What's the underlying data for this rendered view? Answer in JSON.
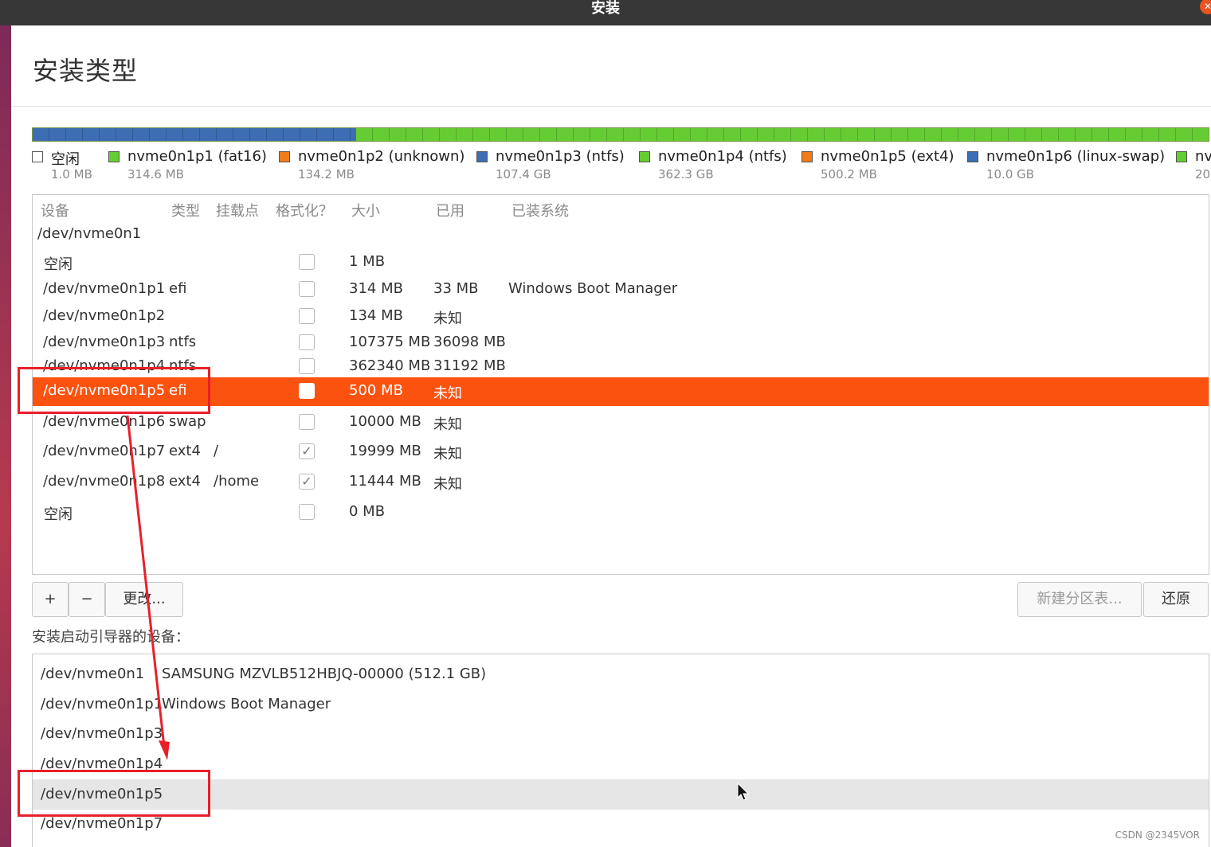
{
  "window": {
    "title": "安装"
  },
  "page": {
    "heading": "安装类型"
  },
  "partition_bar": [
    {
      "color": "#3d6eb4",
      "fraction": 0.275
    },
    {
      "color": "#66cc33",
      "fraction": 0.725
    }
  ],
  "legend": [
    {
      "name": "空闲",
      "size": "1.0 MB",
      "color": "#ffffff"
    },
    {
      "name": "nvme0n1p1 (fat16)",
      "size": "314.6 MB",
      "color": "#66cc33"
    },
    {
      "name": "nvme0n1p2 (unknown)",
      "size": "134.2 MB",
      "color": "#f07b1a"
    },
    {
      "name": "nvme0n1p3 (ntfs)",
      "size": "107.4 GB",
      "color": "#3d6eb4"
    },
    {
      "name": "nvme0n1p4 (ntfs)",
      "size": "362.3 GB",
      "color": "#66cc33"
    },
    {
      "name": "nvme0n1p5 (ext4)",
      "size": "500.2 MB",
      "color": "#f07b1a"
    },
    {
      "name": "nvme0n1p6 (linux-swap)",
      "size": "10.0 GB",
      "color": "#3d6eb4"
    },
    {
      "name": "nv",
      "size": "20",
      "color": "#66cc33"
    }
  ],
  "table": {
    "headers": {
      "device": "设备",
      "type": "类型",
      "mount": "挂载点",
      "format": "格式化？",
      "size": "大小",
      "used": "已用",
      "system": "已装系统"
    },
    "disk": "/dev/nvme0n1",
    "rows": [
      {
        "device": "空闲",
        "type": "",
        "mount": "",
        "format": false,
        "size": "1 MB",
        "used": "",
        "system": ""
      },
      {
        "device": "/dev/nvme0n1p1",
        "type": "efi",
        "mount": "",
        "format": false,
        "size": "314 MB",
        "used": "33 MB",
        "system": "Windows Boot Manager"
      },
      {
        "device": "/dev/nvme0n1p2",
        "type": "",
        "mount": "",
        "format": false,
        "size": "134 MB",
        "used": "未知",
        "system": ""
      },
      {
        "device": "/dev/nvme0n1p3",
        "type": "ntfs",
        "mount": "",
        "format": false,
        "size": "107375 MB",
        "used": "36098 MB",
        "system": ""
      },
      {
        "device": "/dev/nvme0n1p4",
        "type": "ntfs",
        "mount": "",
        "format": false,
        "size": "362340 MB",
        "used": "31192 MB",
        "system": ""
      },
      {
        "device": "/dev/nvme0n1p5",
        "type": "efi",
        "mount": "",
        "format": false,
        "size": "500 MB",
        "used": "未知",
        "system": "",
        "selected": true
      },
      {
        "device": "/dev/nvme0n1p6",
        "type": "swap",
        "mount": "",
        "format": false,
        "size": "10000 MB",
        "used": "未知",
        "system": ""
      },
      {
        "device": "/dev/nvme0n1p7",
        "type": "ext4",
        "mount": "/",
        "format": true,
        "size": "19999 MB",
        "used": "未知",
        "system": ""
      },
      {
        "device": "/dev/nvme0n1p8",
        "type": "ext4",
        "mount": "/home",
        "format": true,
        "size": "11444 MB",
        "used": "未知",
        "system": ""
      },
      {
        "device": "空闲",
        "type": "",
        "mount": "",
        "format": false,
        "size": "0 MB",
        "used": "",
        "system": ""
      }
    ]
  },
  "buttons": {
    "add": "+",
    "remove": "−",
    "change": "更改...",
    "new_table": "新建分区表...",
    "revert": "还原"
  },
  "boot": {
    "label": "安装启动引导器的设备：",
    "items": [
      {
        "device": "/dev/nvme0n1",
        "desc": "SAMSUNG MZVLB512HBJQ-00000 (512.1 GB)"
      },
      {
        "device": "/dev/nvme0n1p1",
        "desc": "Windows Boot Manager"
      },
      {
        "device": "/dev/nvme0n1p3",
        "desc": ""
      },
      {
        "device": "/dev/nvme0n1p4",
        "desc": ""
      },
      {
        "device": "/dev/nvme0n1p5",
        "desc": "",
        "highlighted": true
      },
      {
        "device": "/dev/nvme0n1p7",
        "desc": ""
      }
    ]
  },
  "watermark": "CSDN @2345VOR"
}
